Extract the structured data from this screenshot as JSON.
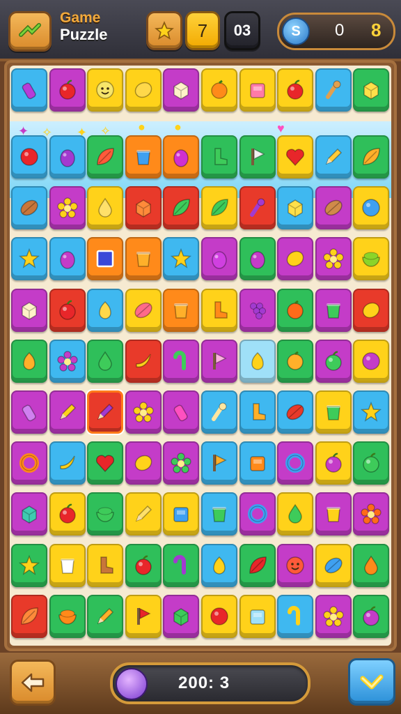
{
  "header": {
    "title_line1": "Game",
    "title_line2": "Puzzle",
    "level": "7",
    "moves": "03",
    "coins_value": "0",
    "coins_extra": "8",
    "menu_icon": "gamepad-icon",
    "star_icon": "star-icon",
    "coin_icon": "coin-icon",
    "coin_symbol": "S"
  },
  "footer": {
    "score_text": "200: 3",
    "back_icon": "back-arrow-icon",
    "confirm_icon": "checkmark-icon"
  },
  "board": {
    "rows": 11,
    "cols": 10,
    "selected": [
      [
        6,
        2
      ]
    ],
    "tiles": [
      [
        [
          "#3fb8f0",
          "#b63cd8",
          "lip"
        ],
        [
          "#c43cc8",
          "#e8262a",
          "apple"
        ],
        [
          "#ffd21a",
          "#f7e56a",
          "face"
        ],
        [
          "#ffd21a",
          "#ffd84a",
          "lemon"
        ],
        [
          "#c43cc8",
          "#fff2c8",
          "cube"
        ],
        [
          "#ffd21a",
          "#ff8a1a",
          "orange"
        ],
        [
          "#ffd21a",
          "#ff7aa8",
          "box"
        ],
        [
          "#ffd21a",
          "#e8262a",
          "apple"
        ],
        [
          "#3fb8f0",
          "#e0a050",
          "pin"
        ],
        [
          "#2fbf5a",
          "#ffe04a",
          "cube"
        ]
      ],
      [
        [
          "#3fb8f0",
          "#e8262a",
          "circle"
        ],
        [
          "#3fb8f0",
          "#a23ad0",
          "plum"
        ],
        [
          "#2fbf5a",
          "#ff5a3a",
          "leaf"
        ],
        [
          "#ff8a1a",
          "#3fa0f0",
          "cup"
        ],
        [
          "#ff8a1a",
          "#d030d0",
          "plum"
        ],
        [
          "#2fbf5a",
          "#3ecb5a",
          "boot"
        ],
        [
          "#2fbf5a",
          "#f2f2f2",
          "flag"
        ],
        [
          "#ffd21a",
          "#e8262a",
          "heart"
        ],
        [
          "#3fb8f0",
          "#ffcc3a",
          "pen"
        ],
        [
          "#2fbf5a",
          "#ffb02a",
          "leaf"
        ]
      ],
      [
        [
          "#3fb8f0",
          "#c8763a",
          "seed"
        ],
        [
          "#c43cc8",
          "#ffd21a",
          "flower"
        ],
        [
          "#ffd21a",
          "#ffe06a",
          "drop"
        ],
        [
          "#e83a2a",
          "#ff8a3a",
          "cube"
        ],
        [
          "#e83a2a",
          "#3ecb5a",
          "leaf"
        ],
        [
          "#ffd21a",
          "#3ecb5a",
          "leaf"
        ],
        [
          "#e83a2a",
          "#a23ad0",
          "pin"
        ],
        [
          "#3fb8f0",
          "#ffe04a",
          "cube"
        ],
        [
          "#c43cc8",
          "#d08a4a",
          "seed"
        ],
        [
          "#ffd21a",
          "#3fa0f0",
          "circle"
        ]
      ],
      [
        [
          "#3fb8f0",
          "#ffd21a",
          "star"
        ],
        [
          "#3fb8f0",
          "#c43cc8",
          "plum"
        ],
        [
          "#ff8a1a",
          "#3a48d8",
          "square"
        ],
        [
          "#ff8a1a",
          "#ffb02a",
          "cup"
        ],
        [
          "#3fb8f0",
          "#ffd21a",
          "star"
        ],
        [
          "#c43cc8",
          "#d040e0",
          "plum"
        ],
        [
          "#2fbf5a",
          "#c43cc8",
          "plum"
        ],
        [
          "#c43cc8",
          "#ffd21a",
          "lemon"
        ],
        [
          "#c43cc8",
          "#ffd21a",
          "flower"
        ],
        [
          "#ffd21a",
          "#8ad42a",
          "bowl"
        ]
      ],
      [
        [
          "#c43cc8",
          "#fff2c8",
          "cube"
        ],
        [
          "#e83a2a",
          "#e8262a",
          "apple"
        ],
        [
          "#3fb8f0",
          "#ffd84a",
          "pear"
        ],
        [
          "#ffd21a",
          "#ff6a8a",
          "seed"
        ],
        [
          "#ff8a1a",
          "#ffb02a",
          "cup"
        ],
        [
          "#ffd21a",
          "#ff8a1a",
          "boot"
        ],
        [
          "#c43cc8",
          "#a23ad0",
          "grapes"
        ],
        [
          "#2fbf5a",
          "#ff6a1a",
          "orange"
        ],
        [
          "#c43cc8",
          "#3ecb5a",
          "cup"
        ],
        [
          "#e83a2a",
          "#ffd21a",
          "lemon"
        ]
      ],
      [
        [
          "#2fbf5a",
          "#ffb02a",
          "pear"
        ],
        [
          "#3fb8f0",
          "#c43cc8",
          "flower"
        ],
        [
          "#2fbf5a",
          "#3ecb5a",
          "drop"
        ],
        [
          "#e83a2a",
          "#ffd21a",
          "banana"
        ],
        [
          "#c43cc8",
          "#3ecb5a",
          "hook"
        ],
        [
          "#c43cc8",
          "#ffb0e0",
          "flag"
        ],
        [
          "#9fe0f8",
          "#ffd21a",
          "pear"
        ],
        [
          "#2fbf5a",
          "#ffb02a",
          "orange"
        ],
        [
          "#c43cc8",
          "#3ecb5a",
          "apple"
        ],
        [
          "#ffd21a",
          "#c43cc8",
          "circle"
        ]
      ],
      [
        [
          "#c43cc8",
          "#d080f0",
          "lip"
        ],
        [
          "#c43cc8",
          "#ffd21a",
          "pen"
        ],
        [
          "#e83a2a",
          "#a23ad0",
          "pen"
        ],
        [
          "#c43cc8",
          "#ffd21a",
          "flower"
        ],
        [
          "#c43cc8",
          "#ff50c0",
          "lip"
        ],
        [
          "#3fb8f0",
          "#ffe6a0",
          "pin"
        ],
        [
          "#3fb8f0",
          "#ffb02a",
          "boot"
        ],
        [
          "#3fb8f0",
          "#e83a2a",
          "seed"
        ],
        [
          "#ffd21a",
          "#3ecb5a",
          "cup"
        ],
        [
          "#3fb8f0",
          "#ffd21a",
          "star"
        ]
      ],
      [
        [
          "#c43cc8",
          "#ff8a1a",
          "ring"
        ],
        [
          "#3fb8f0",
          "#ffd21a",
          "banana"
        ],
        [
          "#2fbf5a",
          "#e8262a",
          "heart"
        ],
        [
          "#c43cc8",
          "#ffd21a",
          "lemon"
        ],
        [
          "#c43cc8",
          "#3ecb5a",
          "flower"
        ],
        [
          "#3fb8f0",
          "#ffb02a",
          "flag"
        ],
        [
          "#3fb8f0",
          "#ff8a1a",
          "box"
        ],
        [
          "#c43cc8",
          "#3fa0f0",
          "ring"
        ],
        [
          "#ffd21a",
          "#c43cc8",
          "apple"
        ],
        [
          "#2fbf5a",
          "#3ecb5a",
          "apple"
        ]
      ],
      [
        [
          "#c43cc8",
          "#3ecbb0",
          "cube"
        ],
        [
          "#ffd21a",
          "#e8262a",
          "apple"
        ],
        [
          "#2fbf5a",
          "#3ecb5a",
          "bowl"
        ],
        [
          "#ffd21a",
          "#ffe06a",
          "pen"
        ],
        [
          "#ffd21a",
          "#3fa0f0",
          "box"
        ],
        [
          "#3fb8f0",
          "#3ecb5a",
          "cup"
        ],
        [
          "#c43cc8",
          "#3fa0f0",
          "ring"
        ],
        [
          "#ffd21a",
          "#3ecb5a",
          "drop"
        ],
        [
          "#c43cc8",
          "#ffd21a",
          "cup"
        ],
        [
          "#c43cc8",
          "#ff6a1a",
          "flower"
        ]
      ],
      [
        [
          "#2fbf5a",
          "#ffd21a",
          "star"
        ],
        [
          "#ffd21a",
          "#ffffff",
          "cup"
        ],
        [
          "#ffd21a",
          "#c8763a",
          "boot"
        ],
        [
          "#2fbf5a",
          "#e8262a",
          "apple"
        ],
        [
          "#2fbf5a",
          "#a23ad0",
          "hook"
        ],
        [
          "#3fb8f0",
          "#ffd21a",
          "pear"
        ],
        [
          "#2fbf5a",
          "#e8262a",
          "leaf"
        ],
        [
          "#c43cc8",
          "#ff5a3a",
          "face"
        ],
        [
          "#ffd21a",
          "#3fa0f0",
          "seed"
        ],
        [
          "#2fbf5a",
          "#ff8a1a",
          "drop"
        ]
      ],
      [
        [
          "#e83a2a",
          "#ff8a3a",
          "leaf"
        ],
        [
          "#2fbf5a",
          "#ff8a1a",
          "bowl"
        ],
        [
          "#2fbf5a",
          "#ffb02a",
          "pen"
        ],
        [
          "#ffd21a",
          "#e8262a",
          "flag"
        ],
        [
          "#c43cc8",
          "#3ecb5a",
          "cube"
        ],
        [
          "#ffd21a",
          "#e8262a",
          "circle"
        ],
        [
          "#ffd21a",
          "#9fe0f8",
          "box"
        ],
        [
          "#3fb8f0",
          "#ffd21a",
          "hook"
        ],
        [
          "#c43cc8",
          "#ffd21a",
          "flower"
        ],
        [
          "#2fbf5a",
          "#c43cc8",
          "apple"
        ]
      ]
    ]
  }
}
